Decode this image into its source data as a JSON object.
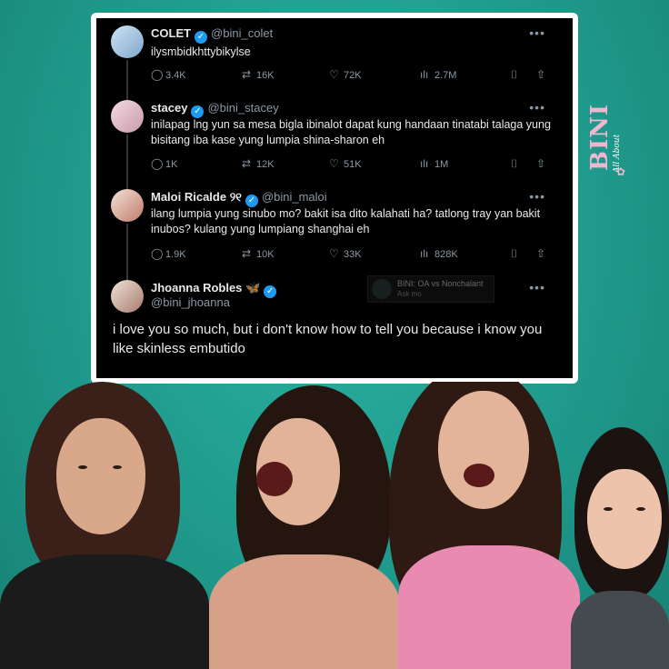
{
  "brand": {
    "word": "BINI",
    "tagline": "All About",
    "mark": "✿"
  },
  "tweets": [
    {
      "name": "COLET",
      "verified": true,
      "handle": "@bini_colet",
      "text": "ilysmbidkhttybikylse",
      "replies": "3.4K",
      "retweets": "16K",
      "likes": "72K",
      "views": "2.7M"
    },
    {
      "name": "stacey",
      "verified": true,
      "handle": "@bini_stacey",
      "text": "inilapag lng yun sa mesa bigla ibinalot dapat kung handaan tinatabi talaga yung bisitang iba kase yung lumpia shina-sharon eh",
      "replies": "1K",
      "retweets": "12K",
      "likes": "51K",
      "views": "1M"
    },
    {
      "name": "Maloi Ricalde ୨୧",
      "verified": true,
      "handle": "@bini_maloi",
      "text": "ilang lumpia yung sinubo mo? bakit isa dito kalahati ha? tatlong tray yan bakit inubos? kulang yung lumpiang shanghai eh",
      "replies": "1.9K",
      "retweets": "10K",
      "likes": "33K",
      "views": "828K"
    },
    {
      "name": "Jhoanna Robles 🦋",
      "verified": true,
      "handle": "@bini_jhoanna",
      "text": "i love you so much, but i don't know how to tell you because i know you like skinless embutido"
    }
  ],
  "thumbnail": {
    "title": "BINI: OA vs Nonchalant",
    "subtitle": "Ask mo"
  },
  "icons": {
    "more": "•••",
    "reply": "speech-bubble-icon",
    "retweet": "retweet-icon",
    "like": "heart-icon",
    "views": "bar-chart-icon",
    "bookmark": "bookmark-icon",
    "share": "share-icon"
  },
  "colors": {
    "background": "#1f9a8c",
    "verified": "#1d9bf0",
    "brand": "#f3b6cf"
  }
}
